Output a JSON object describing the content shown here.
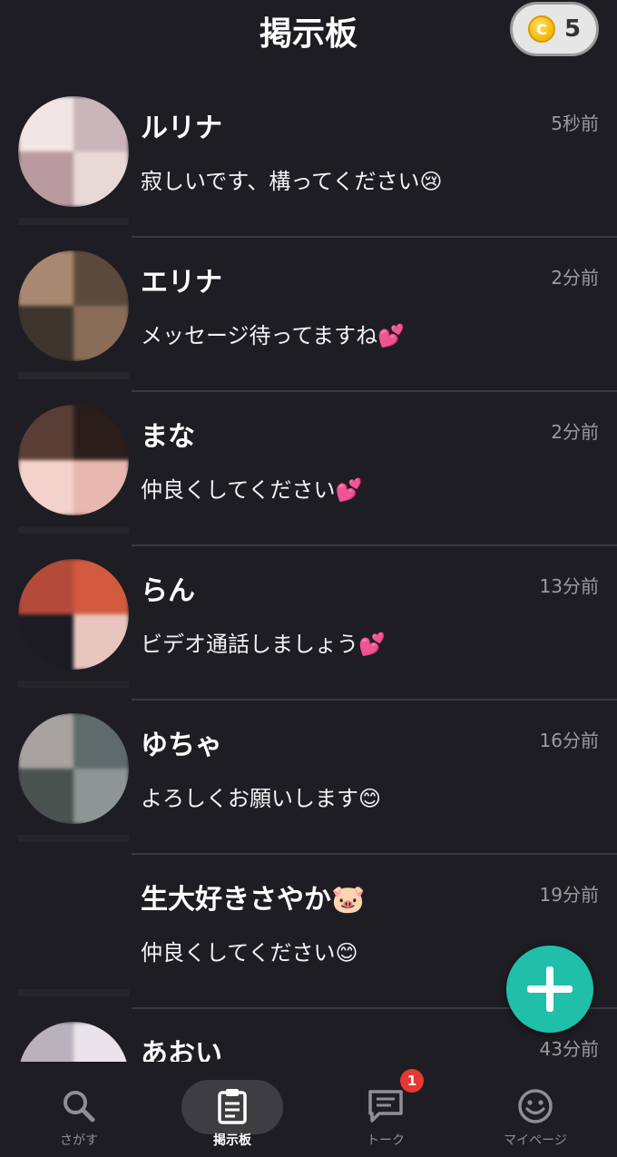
{
  "header": {
    "title": "掲示板",
    "coin_icon": "coin-icon",
    "coin_symbol": "C",
    "coin_count": "5"
  },
  "posts": [
    {
      "name": "ルリナ",
      "time": "5秒前",
      "message": "寂しいです、構ってください😢",
      "avatar_colors": [
        "#c9b6b8",
        "#e8d9d6",
        "#b99a9e",
        "#f2e6e4"
      ]
    },
    {
      "name": "エリナ",
      "time": "2分前",
      "message": "メッセージ待ってますね💕",
      "avatar_colors": [
        "#5b4a3c",
        "#8a6d58",
        "#3d352d",
        "#a88870"
      ]
    },
    {
      "name": "まな",
      "time": "2分前",
      "message": "仲良くしてください💕",
      "avatar_colors": [
        "#2b1d1a",
        "#e8b7b0",
        "#f4d2cc",
        "#5a3e36"
      ]
    },
    {
      "name": "らん",
      "time": "13分前",
      "message": "ビデオ通話しましょう💕",
      "avatar_colors": [
        "#d25a3e",
        "#e8c6bf",
        "#1c1a22",
        "#b44b3a"
      ]
    },
    {
      "name": "ゆちゃ",
      "time": "16分前",
      "message": "よろしくお願いします😊",
      "avatar_colors": [
        "#5f6b6a",
        "#8d9694",
        "#4a5250",
        "#a7a3a0"
      ]
    },
    {
      "name": "生大好きさやか🐷",
      "time": "19分前",
      "message": "仲良くしてください😊",
      "avatar_colors": []
    },
    {
      "name": "あおい",
      "time": "43分前",
      "message": "",
      "avatar_colors": [
        "#e8e4ea",
        "#c9c3cc",
        "#f4f1f6",
        "#b9b2bd"
      ]
    }
  ],
  "fab": {
    "icon": "plus-icon"
  },
  "nav": {
    "items": [
      {
        "label": "さがす",
        "icon": "search-icon"
      },
      {
        "label": "掲示板",
        "icon": "clipboard-icon"
      },
      {
        "label": "トーク",
        "icon": "chat-icon"
      },
      {
        "label": "マイページ",
        "icon": "smiley-icon"
      }
    ],
    "active_index": 1,
    "talk_badge": "1"
  }
}
